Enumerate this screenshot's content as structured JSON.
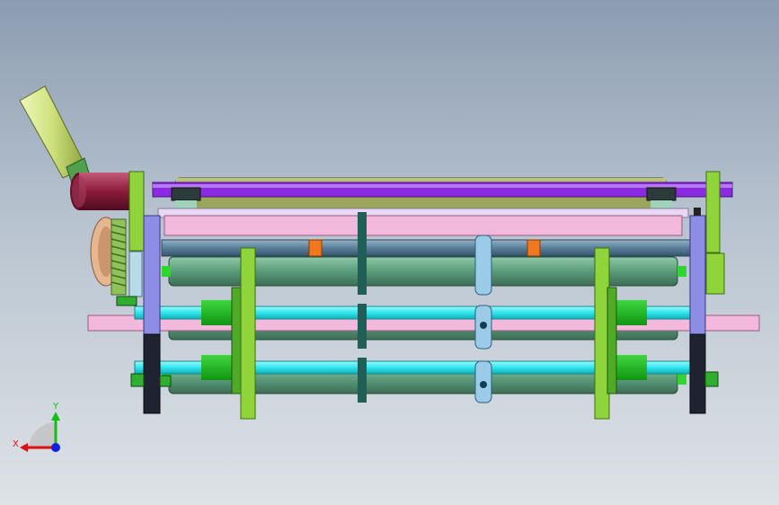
{
  "triad": {
    "x_label": "X",
    "y_label": "Y",
    "x_color": "#e01010",
    "y_color": "#10c010",
    "z_color": "#1020e0"
  },
  "colors": {
    "top_plate": "#9aa55a",
    "pink_bar": "#f3b9dc",
    "purple_plate": "#8d8de6",
    "green_plate": "#8fd43a",
    "roller": "#5f9f7f",
    "cyan_shaft": "#2ee6ee",
    "steel_rod": "#5a7f9a",
    "orange_clip": "#f2781f",
    "motor": "#8b1b3a",
    "handle": "#cde07a",
    "violet_shaft": "#8a2be2",
    "dark_bracket": "#1f2230",
    "spring": "#8fc25a",
    "clamp_blue": "#6fb0e0"
  }
}
